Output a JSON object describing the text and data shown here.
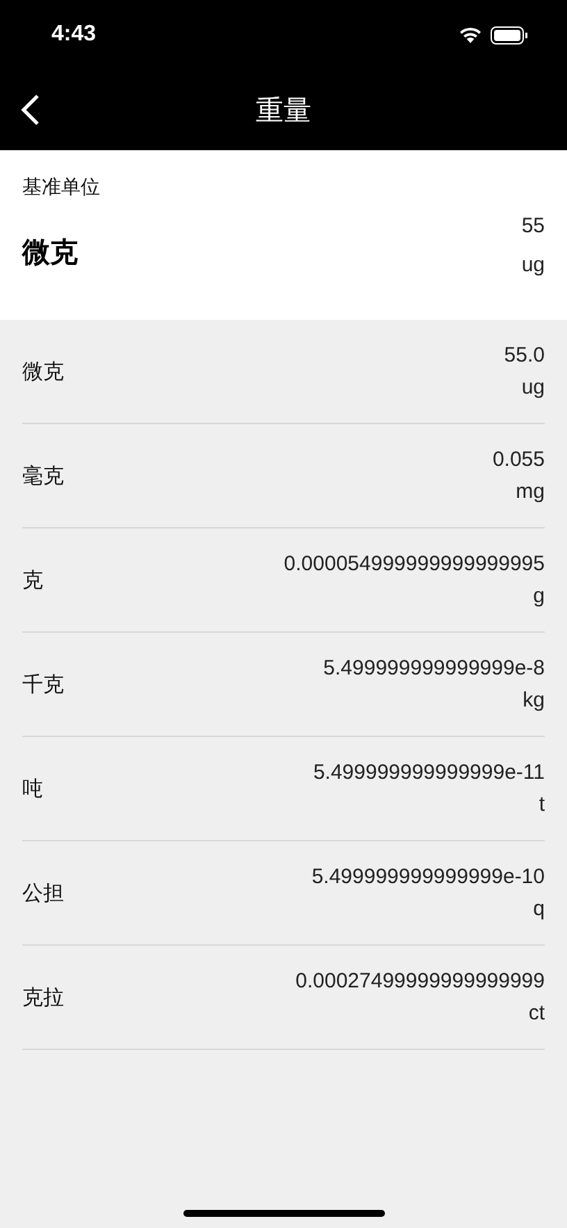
{
  "status_bar": {
    "time": "4:43"
  },
  "nav": {
    "title": "重量"
  },
  "base": {
    "label": "基准单位",
    "unit_name": "微克",
    "value": "55",
    "unit": "ug"
  },
  "rows": [
    {
      "name": "微克",
      "value": "55.0",
      "unit": "ug"
    },
    {
      "name": "毫克",
      "value": "0.055",
      "unit": "mg"
    },
    {
      "name": "克",
      "value": "0.000054999999999999995",
      "unit": "g"
    },
    {
      "name": "千克",
      "value": "5.499999999999999e-8",
      "unit": "kg"
    },
    {
      "name": "吨",
      "value": "5.499999999999999e-11",
      "unit": "t"
    },
    {
      "name": "公担",
      "value": "5.499999999999999e-10",
      "unit": "q"
    },
    {
      "name": "克拉",
      "value": "0.00027499999999999999",
      "unit": "ct"
    }
  ]
}
